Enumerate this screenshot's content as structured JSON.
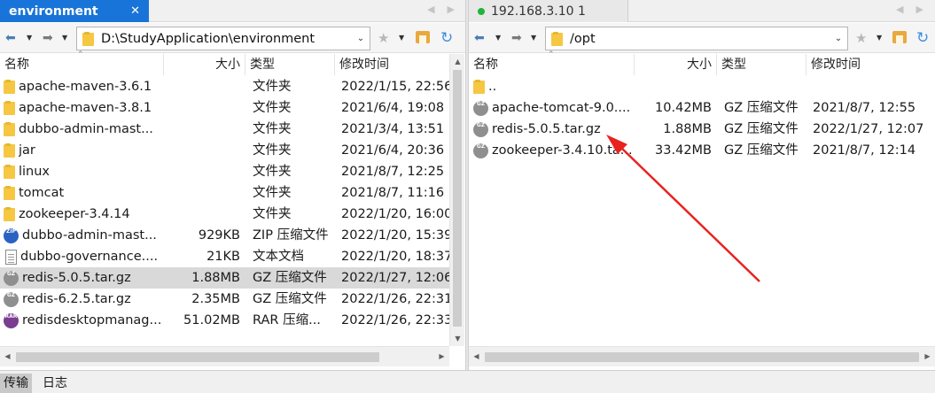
{
  "left": {
    "tab_label": "environment",
    "tab_close": "✕",
    "address": "D:\\StudyApplication\\environment",
    "columns": [
      "名称",
      "大小",
      "类型",
      "修改时间"
    ],
    "rows": [
      {
        "name": "apache-maven-3.6.1",
        "size": "",
        "type": "文件夹",
        "modified": "2022/1/15, 22:56",
        "icon": "folder-icon"
      },
      {
        "name": "apache-maven-3.8.1",
        "size": "",
        "type": "文件夹",
        "modified": "2021/6/4, 19:08",
        "icon": "folder-icon"
      },
      {
        "name": "dubbo-admin-mast...",
        "size": "",
        "type": "文件夹",
        "modified": "2021/3/4, 13:51",
        "icon": "folder-icon"
      },
      {
        "name": "jar",
        "size": "",
        "type": "文件夹",
        "modified": "2021/6/4, 20:36",
        "icon": "folder-icon"
      },
      {
        "name": "linux",
        "size": "",
        "type": "文件夹",
        "modified": "2021/8/7, 12:25",
        "icon": "folder-icon"
      },
      {
        "name": "tomcat",
        "size": "",
        "type": "文件夹",
        "modified": "2021/8/7, 11:16",
        "icon": "folder-icon"
      },
      {
        "name": "zookeeper-3.4.14",
        "size": "",
        "type": "文件夹",
        "modified": "2022/1/20, 16:00",
        "icon": "folder-icon"
      },
      {
        "name": "dubbo-admin-mast...",
        "size": "929KB",
        "type": "ZIP 压缩文件",
        "modified": "2022/1/20, 15:39",
        "icon": "zip-icon"
      },
      {
        "name": "dubbo-governance....",
        "size": "21KB",
        "type": "文本文档",
        "modified": "2022/1/20, 18:37",
        "icon": "text-file-icon"
      },
      {
        "name": "redis-5.0.5.tar.gz",
        "size": "1.88MB",
        "type": "GZ 压缩文件",
        "modified": "2022/1/27, 12:06",
        "icon": "gz-icon",
        "selected": true
      },
      {
        "name": "redis-6.2.5.tar.gz",
        "size": "2.35MB",
        "type": "GZ 压缩文件",
        "modified": "2022/1/26, 22:31",
        "icon": "gz-icon"
      },
      {
        "name": "redisdesktopmanag...",
        "size": "51.02MB",
        "type": "RAR 压缩...",
        "modified": "2022/1/26, 22:33",
        "icon": "rar-icon"
      }
    ]
  },
  "right": {
    "tab_label": "192.168.3.10 1",
    "address": "/opt",
    "columns": [
      "名称",
      "大小",
      "类型",
      "修改时间"
    ],
    "rows": [
      {
        "name": "..",
        "size": "",
        "type": "",
        "modified": "",
        "icon": "folder-icon"
      },
      {
        "name": "apache-tomcat-9.0....",
        "size": "10.42MB",
        "type": "GZ 压缩文件",
        "modified": "2021/8/7, 12:55",
        "icon": "gz-icon"
      },
      {
        "name": "redis-5.0.5.tar.gz",
        "size": "1.88MB",
        "type": "GZ 压缩文件",
        "modified": "2022/1/27, 12:07",
        "icon": "gz-icon"
      },
      {
        "name": "zookeeper-3.4.10.ta...",
        "size": "33.42MB",
        "type": "GZ 压缩文件",
        "modified": "2021/8/7, 12:14",
        "icon": "gz-icon"
      }
    ]
  },
  "bottom_tabs": [
    "传输",
    "日志"
  ],
  "icon_text": {
    "gz": "GZ",
    "zip": "ZIP",
    "rar": "RAR"
  },
  "colors": {
    "tab_active": "#1874d8",
    "connected_dot": "#1fb33a",
    "arrow": "#e8231f",
    "selected_row": "#d9d9d9"
  }
}
